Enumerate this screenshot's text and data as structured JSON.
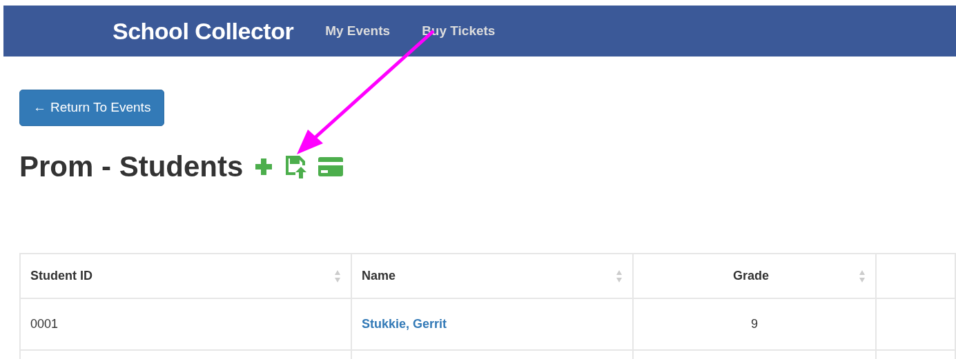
{
  "navbar": {
    "brand": "School Collector",
    "links": [
      {
        "label": "My Events"
      },
      {
        "label": "Buy Tickets"
      }
    ]
  },
  "back_button": {
    "icon": "←",
    "label": "Return To Events"
  },
  "page_title": "Prom - Students",
  "title_actions": [
    {
      "kind": "add"
    },
    {
      "kind": "save-upload"
    },
    {
      "kind": "card"
    }
  ],
  "table": {
    "columns": [
      {
        "label": "Student ID",
        "sortable": true
      },
      {
        "label": "Name",
        "sortable": true
      },
      {
        "label": "Grade",
        "sortable": true
      }
    ],
    "rows": [
      {
        "cells": [
          "0001",
          "Stukkie, Gerrit",
          "9"
        ]
      }
    ]
  },
  "annotation": {
    "kind": "arrow",
    "color": "#ff00ff"
  }
}
